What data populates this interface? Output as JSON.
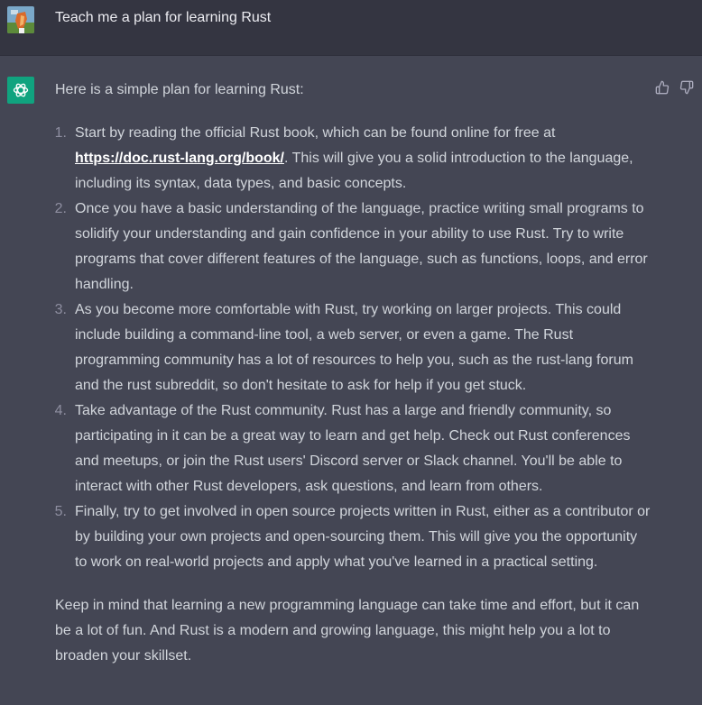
{
  "user_message": {
    "text": "Teach me a plan for learning Rust"
  },
  "assistant_message": {
    "intro": "Here is a simple plan for learning Rust:",
    "steps": [
      {
        "number": "1.",
        "before": "Start by reading the official Rust book, which can be found online for free at ",
        "link": "https://doc.rust-lang.org/book/",
        "after": ". This will give you a solid introduction to the language, including its syntax, data types, and basic concepts."
      },
      {
        "number": "2.",
        "text": "Once you have a basic understanding of the language, practice writing small programs to solidify your understanding and gain confidence in your ability to use Rust. Try to write programs that cover different features of the language, such as functions, loops, and error handling."
      },
      {
        "number": "3.",
        "text": "As you become more comfortable with Rust, try working on larger projects. This could include building a command-line tool, a web server, or even a game. The Rust programming community has a lot of resources to help you, such as the rust-lang forum and the rust subreddit, so don't hesitate to ask for help if you get stuck."
      },
      {
        "number": "4.",
        "text": "Take advantage of the Rust community. Rust has a large and friendly community, so participating in it can be a great way to learn and get help. Check out Rust conferences and meetups, or join the Rust users' Discord server or Slack channel. You'll be able to interact with other Rust developers, ask questions, and learn from others."
      },
      {
        "number": "5.",
        "text": "Finally, try to get involved in open source projects written in Rust, either as a contributor or by building your own projects and open-sourcing them. This will give you the opportunity to work on real-world projects and apply what you've learned in a practical setting."
      }
    ],
    "closing": "Keep in mind that learning a new programming language can take time and effort, but it can be a lot of fun. And Rust is a modern and growing language, this might help you a lot to broaden your skillset."
  },
  "icons": {
    "user_avatar": "user-avatar-image",
    "assistant_avatar": "openai-logo-icon",
    "thumbs_up": "thumbs-up-icon",
    "thumbs_down": "thumbs-down-icon"
  },
  "colors": {
    "user_row_bg": "#343541",
    "assistant_row_bg": "#444654",
    "assistant_avatar_bg": "#10a37f",
    "text": "#d1d5db"
  }
}
